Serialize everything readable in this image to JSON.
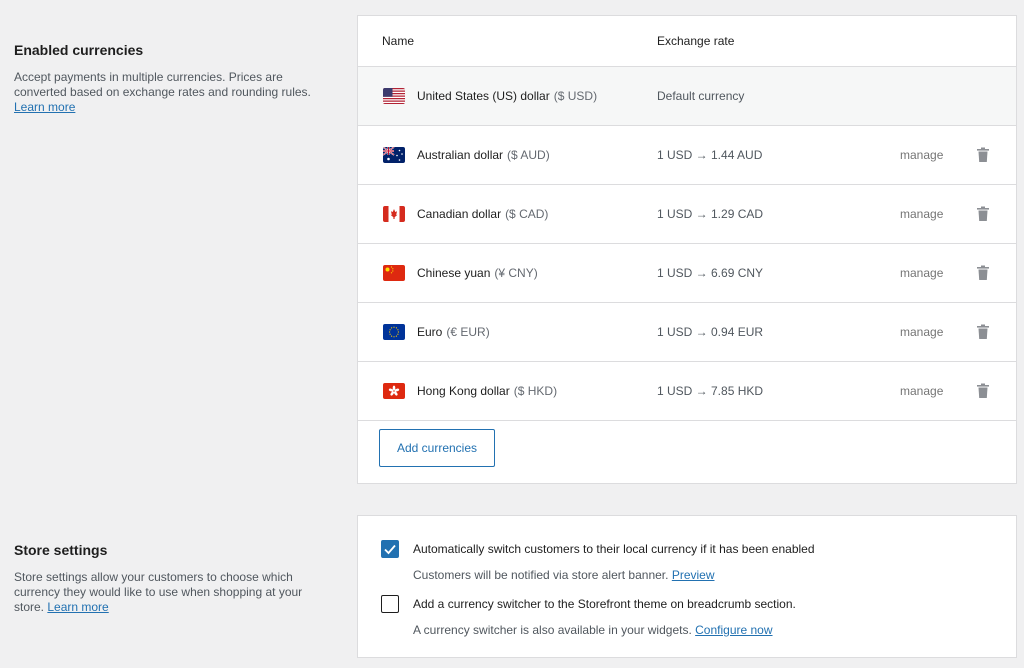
{
  "enabled_currencies": {
    "title": "Enabled currencies",
    "description": "Accept payments in multiple currencies. Prices are converted based on exchange rates and rounding rules.",
    "learn_more": "Learn more",
    "table": {
      "col_name": "Name",
      "col_rate": "Exchange rate",
      "rows": [
        {
          "flag": "us-flag-icon",
          "name": "United States (US) dollar",
          "code": "($ USD)",
          "rate": "Default currency",
          "manage": "",
          "default": true
        },
        {
          "flag": "au-flag-icon",
          "name": "Australian dollar",
          "code": "($ AUD)",
          "rate": "1 USD → 1.44 AUD",
          "manage": "manage"
        },
        {
          "flag": "ca-flag-icon",
          "name": "Canadian dollar",
          "code": "($ CAD)",
          "rate": "1 USD → 1.29 CAD",
          "manage": "manage"
        },
        {
          "flag": "cn-flag-icon",
          "name": "Chinese yuan",
          "code": "(¥ CNY)",
          "rate": "1 USD → 6.69 CNY",
          "manage": "manage"
        },
        {
          "flag": "eu-flag-icon",
          "name": "Euro",
          "code": "(€ EUR)",
          "rate": "1 USD → 0.94 EUR",
          "manage": "manage"
        },
        {
          "flag": "hk-flag-icon",
          "name": "Hong Kong dollar",
          "code": "($ HKD)",
          "rate": "1 USD → 7.85 HKD",
          "manage": "manage"
        }
      ]
    },
    "add_button": "Add currencies"
  },
  "store_settings": {
    "title": "Store settings",
    "description": "Store settings allow your customers to choose which currency they would like to use when shopping at your store.",
    "learn_more": "Learn more",
    "options": [
      {
        "label": "Automatically switch customers to their local currency if it has been enabled",
        "help": "Customers will be notified via store alert banner.",
        "link": "Preview",
        "checked": true
      },
      {
        "label": "Add a currency switcher to the Storefront theme on breadcrumb section.",
        "help": "A currency switcher is also available in your widgets.",
        "link": "Configure now",
        "checked": false
      }
    ]
  },
  "colors": {
    "accent": "#2271b1",
    "background": "#f0f0f1",
    "border": "#dcdcde"
  }
}
